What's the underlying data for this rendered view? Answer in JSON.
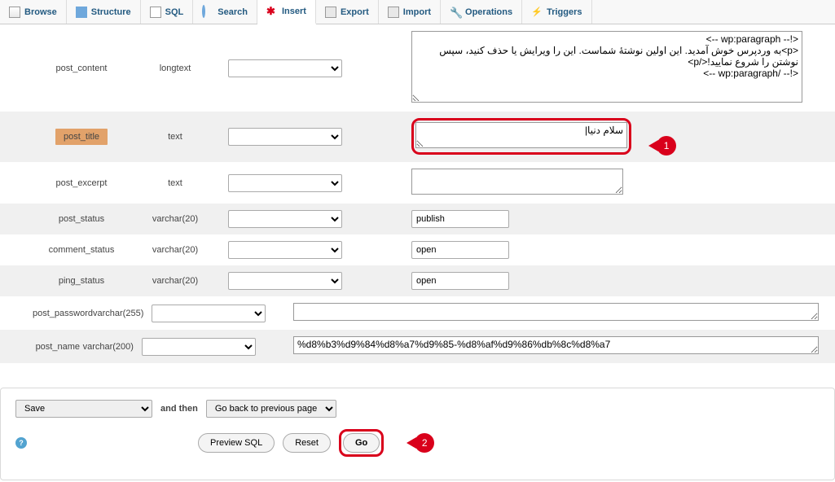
{
  "tabs": {
    "browse": "Browse",
    "structure": "Structure",
    "sql": "SQL",
    "search": "Search",
    "insert": "Insert",
    "export": "Export",
    "import": "Import",
    "operations": "Operations",
    "triggers": "Triggers"
  },
  "fields": {
    "post_content": {
      "name": "post_content",
      "type": "longtext",
      "value": "<!-- wp:paragraph -->\n<p>به وردپرس خوش آمدید. این اولین نوشتهٔ شماست. این را ویرایش یا حذف کنید، سپس نوشتن را شروع نمایید!</p>\n<!-- /wp:paragraph -->"
    },
    "post_title": {
      "name": "post_title",
      "type": "text",
      "value": "سلام دنیا|"
    },
    "post_excerpt": {
      "name": "post_excerpt",
      "type": "text",
      "value": ""
    },
    "post_status": {
      "name": "post_status",
      "type": "varchar(20)",
      "value": "publish"
    },
    "comment_status": {
      "name": "comment_status",
      "type": "varchar(20)",
      "value": "open"
    },
    "ping_status": {
      "name": "ping_status",
      "type": "varchar(20)",
      "value": "open"
    },
    "post_password": {
      "name": "post_password",
      "type": "varchar(255)",
      "value": ""
    },
    "post_name": {
      "name": "post_name",
      "type": "varchar(200)",
      "value": "%d8%b3%d9%84%d8%a7%d9%85-%d8%af%d9%86%db%8c%d8%a7"
    }
  },
  "footer": {
    "save": "Save",
    "and_then": "and then",
    "go_back": "Go back to previous page",
    "preview_sql": "Preview SQL",
    "reset": "Reset",
    "go": "Go"
  },
  "callouts": {
    "one": "1",
    "two": "2"
  }
}
